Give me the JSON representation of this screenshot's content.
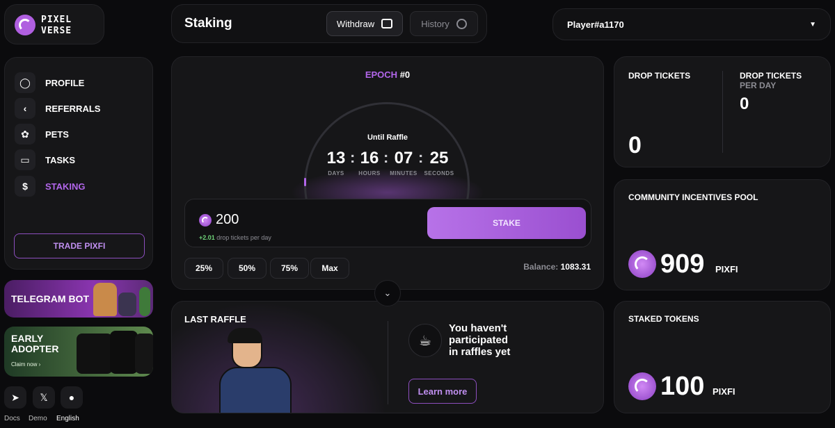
{
  "brand": {
    "line1": "PIXEL",
    "line2": "VERSE"
  },
  "nav": [
    {
      "label": "PROFILE",
      "icon": "user-icon"
    },
    {
      "label": "REFERRALS",
      "icon": "share-icon"
    },
    {
      "label": "PETS",
      "icon": "paw-icon"
    },
    {
      "label": "TASKS",
      "icon": "clipboard-icon"
    },
    {
      "label": "STAKING",
      "icon": "coin-icon"
    }
  ],
  "trade_label": "TRADE PIXFI",
  "promos": {
    "telegram": "TELEGRAM BOT",
    "early_line1": "EARLY",
    "early_line2": "ADOPTER",
    "claim": "Claim now"
  },
  "footer": {
    "docs": "Docs",
    "demo": "Demo",
    "lang": "English"
  },
  "header": {
    "title": "Staking",
    "withdraw": "Withdraw",
    "history": "History"
  },
  "user": {
    "name": "Player#a1170"
  },
  "stake": {
    "epoch_label": "EPOCH",
    "epoch_value": "#0",
    "until": "Until Raffle",
    "timer": {
      "days": "13",
      "hours": "16",
      "minutes": "07",
      "seconds": "25"
    },
    "timer_labels": {
      "days": "DAYS",
      "hours": "HOURS",
      "minutes": "MINUTES",
      "seconds": "SECONDS"
    },
    "amount": "200",
    "rate_value": "+2.01",
    "rate_text": "drop tickets per day",
    "stake_button": "STAKE",
    "pcts": [
      "25%",
      "50%",
      "75%",
      "Max"
    ],
    "balance_label": "Balance:",
    "balance_value": "1083.31"
  },
  "raffle": {
    "title": "LAST RAFFLE",
    "msg1": "You haven't",
    "msg2": "participated",
    "msg3": "in raffles yet",
    "learn": "Learn more"
  },
  "tickets": {
    "label": "DROP TICKETS",
    "value": "0",
    "perday_label1": "DROP TICKETS",
    "perday_label2": "PER DAY",
    "perday_value": "0"
  },
  "pool": {
    "label": "COMMUNITY INCENTIVES POOL",
    "value": "909",
    "unit": "PIXFI"
  },
  "staked": {
    "label": "STAKED TOKENS",
    "value": "100",
    "unit": "PIXFI"
  },
  "colors": {
    "accent": "#b266ea",
    "bg": "#0b0b0d",
    "card": "#161618"
  }
}
